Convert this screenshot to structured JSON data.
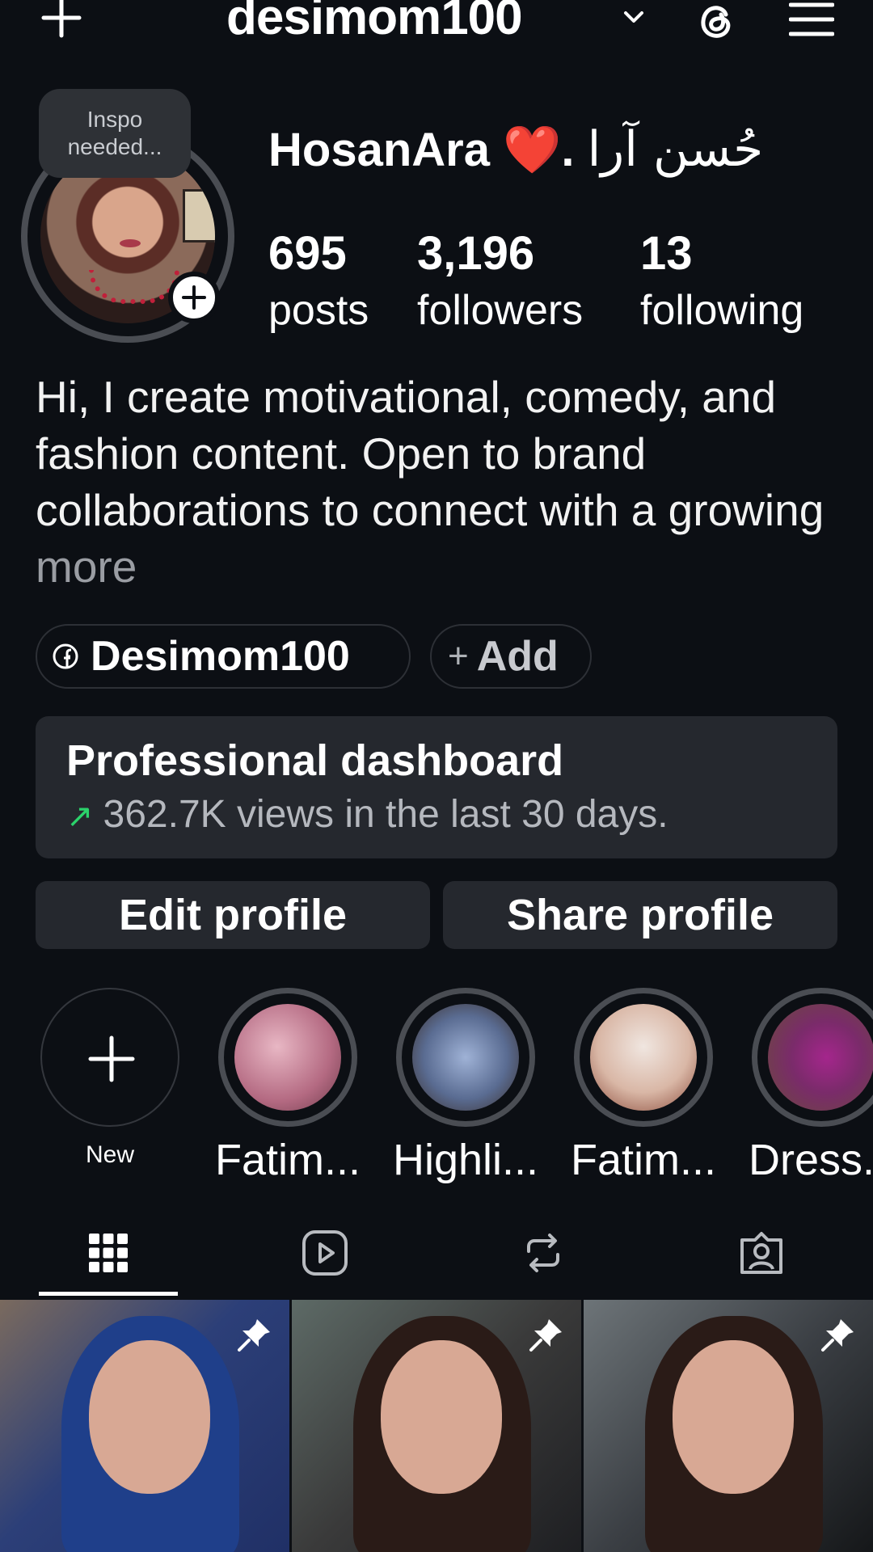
{
  "header": {
    "username": "desimom100"
  },
  "profile": {
    "note": "Inspo needed...",
    "display_name": "HosanAra",
    "heart": "❤️",
    "separator": ".",
    "urdu_name": "حُسن آرا",
    "stats": [
      {
        "value": "695",
        "label": "posts"
      },
      {
        "value": "3,196",
        "label": "followers"
      },
      {
        "value": "13",
        "label": "following"
      }
    ],
    "bio": "Hi, I create motivational, comedy, and fashion content. Open to brand collaborations to connect with a growing",
    "bio_more": "more",
    "links": {
      "facebook_label": "Desimom100",
      "add_label": "Add"
    }
  },
  "dashboard": {
    "title": "Professional dashboard",
    "subtitle": "362.7K views in the last 30 days."
  },
  "buttons": {
    "edit": "Edit profile",
    "share": "Share profile"
  },
  "highlights": [
    {
      "label": "New"
    },
    {
      "label": "Fatim..."
    },
    {
      "label": "Highli..."
    },
    {
      "label": "Fatim..."
    },
    {
      "label": "Dress..."
    }
  ],
  "tabs": [
    "grid-icon",
    "reels-icon",
    "reposts-icon",
    "tagged-icon"
  ],
  "colors": {
    "background": "#0c0f14",
    "surface": "#25282e",
    "accent_green": "#2bd26b",
    "heart": "#e5233b"
  }
}
